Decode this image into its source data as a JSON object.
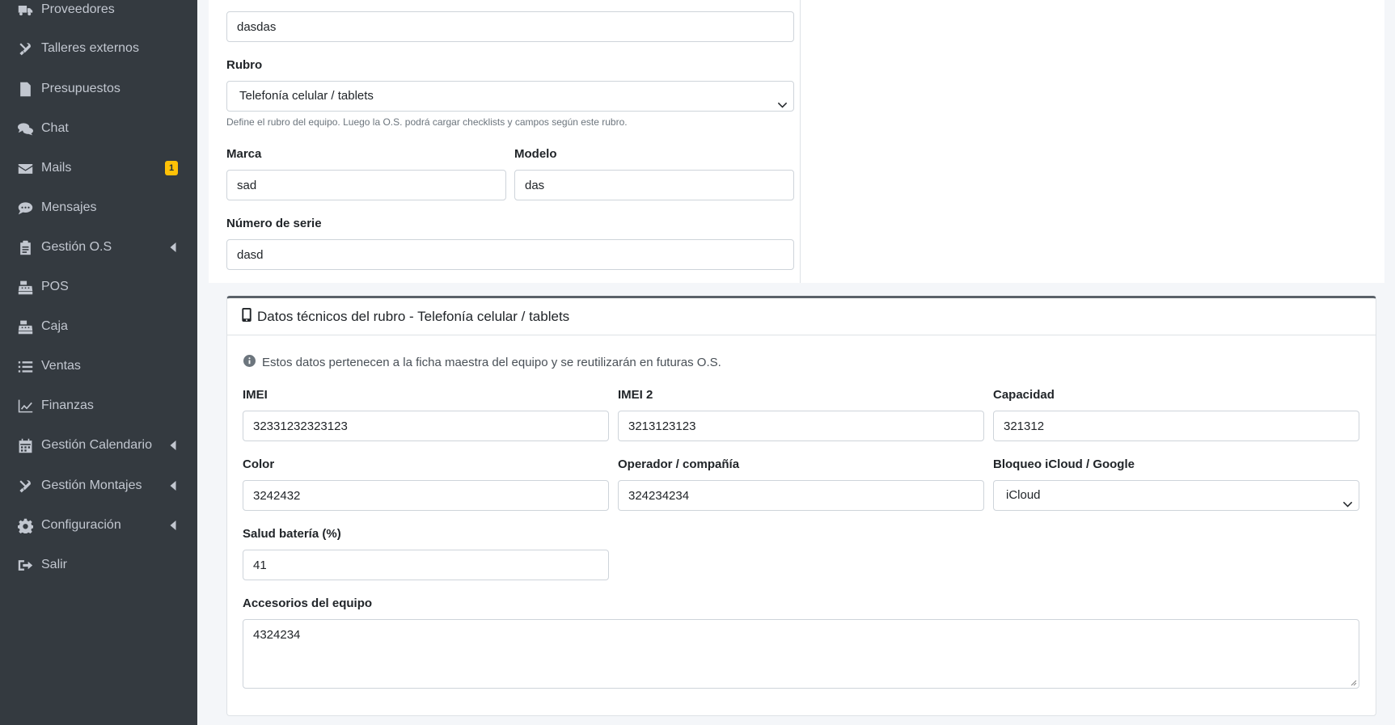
{
  "sidebar": {
    "items": [
      {
        "label": "Proveedores",
        "icon": "truck-icon"
      },
      {
        "label": "Talleres externos",
        "icon": "tools-icon"
      },
      {
        "label": "Presupuestos",
        "icon": "invoice-icon"
      },
      {
        "label": "Chat",
        "icon": "comments-icon"
      },
      {
        "label": "Mails",
        "icon": "envelope-icon",
        "badge": "1"
      },
      {
        "label": "Mensajes",
        "icon": "comment-dots-icon"
      },
      {
        "label": "Gestión O.S",
        "icon": "clipboard-icon"
      },
      {
        "label": "POS",
        "icon": "cash-register-icon"
      },
      {
        "label": "Caja",
        "icon": "cash-register-icon"
      },
      {
        "label": "Ventas",
        "icon": "list-icon"
      },
      {
        "label": "Finanzas",
        "icon": "chart-line-icon"
      },
      {
        "label": "Gestión Calendario",
        "icon": "calendar-icon"
      },
      {
        "label": "Gestión Montajes",
        "icon": "tools-icon"
      },
      {
        "label": "Configuración",
        "icon": "cog-icon"
      },
      {
        "label": "Salir",
        "icon": "sign-out-icon"
      }
    ]
  },
  "equipo": {
    "tipo_value": "dasdas",
    "rubro_label": "Rubro",
    "rubro_value": "Telefonía celular / tablets",
    "rubro_help": "Define el rubro del equipo. Luego la O.S. podrá cargar checklists y campos según este rubro.",
    "marca_label": "Marca",
    "marca_value": "sad",
    "modelo_label": "Modelo",
    "modelo_value": "das",
    "serie_label": "Número de serie",
    "serie_value": "dasd"
  },
  "tech_card": {
    "title": "Datos técnicos del rubro - Telefonía celular / tablets",
    "info": "Estos datos pertenecen a la ficha maestra del equipo y se reutilizarán en futuras O.S.",
    "imei_label": "IMEI",
    "imei_value": "32331232323123",
    "imei2_label": "IMEI 2",
    "imei2_value": "3213123123",
    "capacidad_label": "Capacidad",
    "capacidad_value": "321312",
    "color_label": "Color",
    "color_value": "3242432",
    "operador_label": "Operador / compañía",
    "operador_value": "324234234",
    "bloqueo_label": "Bloqueo iCloud / Google",
    "bloqueo_value": "iCloud",
    "bateria_label": "Salud batería (%)",
    "bateria_value": "41",
    "accesorios_label": "Accesorios del equipo",
    "accesorios_value": "4324234"
  },
  "colors": {
    "sidebar_bg": "#343a40",
    "badge": "#ffc107",
    "card_top_border": "#5a6169"
  }
}
